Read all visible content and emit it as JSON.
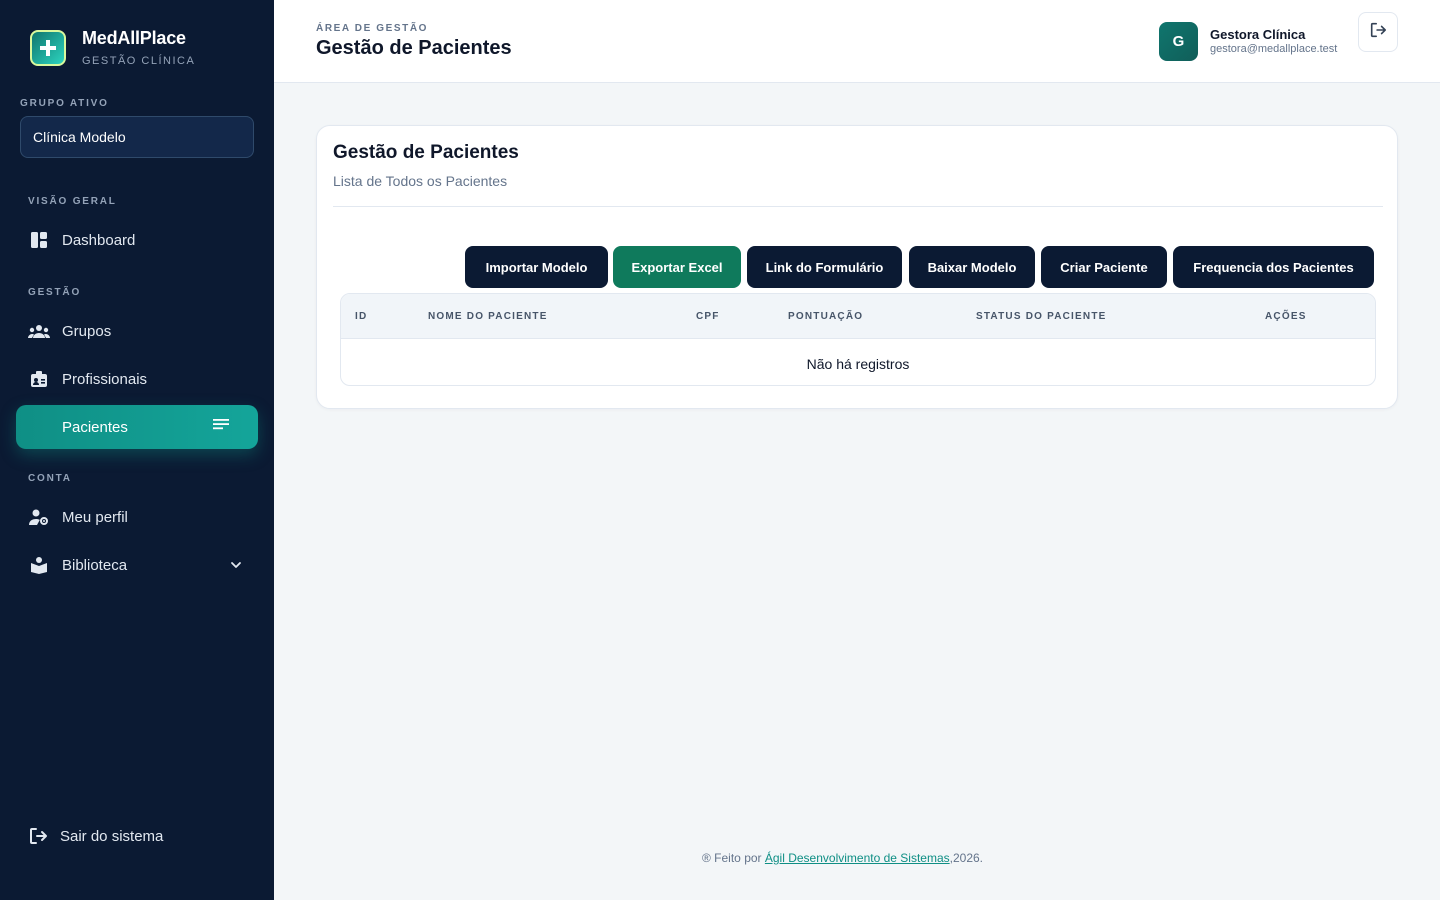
{
  "brand": {
    "name": "MedAllPlace",
    "subtitle": "GESTÃO CLÍNICA"
  },
  "active_group": {
    "label": "GRUPO ATIVO",
    "value": "Clínica Modelo"
  },
  "sidebar": {
    "sections": [
      {
        "label": "VISÃO GERAL"
      },
      {
        "label": "GESTÃO"
      },
      {
        "label": "CONTA"
      }
    ],
    "items": [
      {
        "label": "Dashboard",
        "icon": "dashboard-icon"
      },
      {
        "label": "Grupos",
        "icon": "groups-icon"
      },
      {
        "label": "Profissionais",
        "icon": "badge-icon"
      },
      {
        "label": "Pacientes",
        "icon": "lines-icon",
        "active": true
      },
      {
        "label": "Meu perfil",
        "icon": "user-gear-icon"
      },
      {
        "label": "Biblioteca",
        "icon": "library-icon"
      }
    ],
    "logout": "Sair do sistema"
  },
  "header": {
    "kicker": "ÁREA DE GESTÃO",
    "title": "Gestão de Pacientes",
    "user": {
      "initial": "G",
      "name": "Gestora Clínica",
      "email": "gestora@medallplace.test"
    }
  },
  "card": {
    "title": "Gestão de Pacientes",
    "subtitle": "Lista de Todos os Pacientes",
    "buttons": [
      {
        "label": "Importar Modelo"
      },
      {
        "label": "Exportar Excel"
      },
      {
        "label": "Link do Formulário"
      },
      {
        "label": "Baixar Modelo"
      },
      {
        "label": "Criar Paciente"
      },
      {
        "label": "Frequencia dos Pacientes"
      }
    ],
    "table": {
      "columns": [
        "ID",
        "NOME DO PACIENTE",
        "CPF",
        "PONTUAÇÃO",
        "STATUS DO PACIENTE",
        "AÇÕES"
      ],
      "empty": "Não há registros"
    }
  },
  "footer": {
    "prefix": "® Feito por ",
    "link": "Ágil Desenvolvimento de Sistemas",
    "suffix": ",2026."
  },
  "colors": {
    "sidebar_bg": "#0b1a33",
    "accent_teal": "#14a59a",
    "export_green": "#0f7a5c"
  }
}
